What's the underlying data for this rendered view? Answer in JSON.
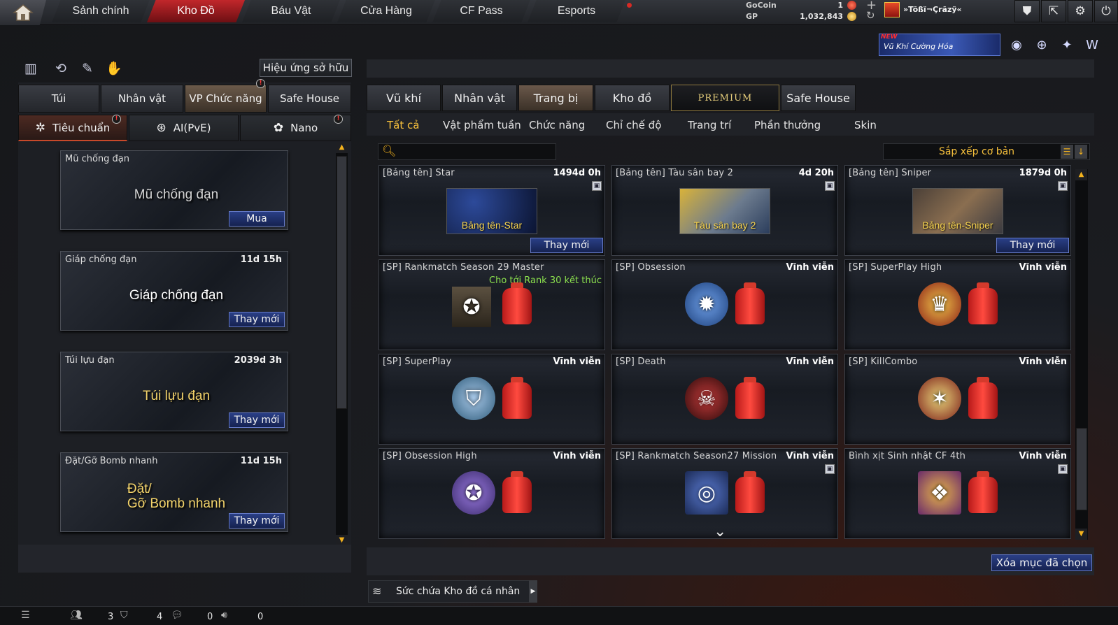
{
  "nav": {
    "tabs": [
      "Sảnh chính",
      "Kho Đồ",
      "Báu Vật",
      "Cửa Hàng",
      "CF Pass",
      "Esports"
    ],
    "active_tab": "Kho Đồ"
  },
  "currency": {
    "gocoin_label": "GoCoin",
    "gocoin_value": "1",
    "gp_label": "GP",
    "gp_value": "1,032,843"
  },
  "player": {
    "name": "»Tõßï¬Çrãzÿ«"
  },
  "event_banner": {
    "badge": "NEW",
    "text": "Vũ Khí Cường Hóa"
  },
  "left": {
    "effect_button": "Hiệu ứng sở hữu",
    "tabs": [
      "Túi",
      "Nhân vật",
      "VP Chức năng",
      "Safe House"
    ],
    "active_tab": "VP Chức năng",
    "subtabs": [
      "Tiêu chuẩn",
      "AI(PvE)",
      "Nano"
    ],
    "active_subtab": "Tiêu chuẩn",
    "items": [
      {
        "title": "Mũ chống đạn",
        "time": "",
        "art": "Mũ chống đạn",
        "button": "Mua"
      },
      {
        "title": "Giáp chống đạn",
        "time": "11d 15h",
        "art": "Giáp chống đạn",
        "button": "Thay mới"
      },
      {
        "title": "Túi lựu đạn",
        "time": "2039d 3h",
        "art": "Túi lựu đạn",
        "button": "Thay mới"
      },
      {
        "title": "Đặt/Gỡ Bomb nhanh",
        "time": "11d 15h",
        "art": "Đặt/\nGỡ Bomb nhanh",
        "button": "Thay mới"
      }
    ]
  },
  "right": {
    "tabs": [
      "Vũ khí",
      "Nhân vật",
      "Trang bị",
      "Kho đồ",
      "PREMIUM",
      "Safe House"
    ],
    "active_tab": "Trang bị",
    "subtabs": [
      "Tất cả",
      "Vật phẩm tuần",
      "Chức năng",
      "Chỉ chế độ",
      "Trang trí",
      "Phần thưởng",
      "Skin"
    ],
    "active_subtab": "Tất cả",
    "search_placeholder": "",
    "sort_label": "Sắp xếp cơ bản",
    "items": [
      {
        "title": "[Bảng tên] Star",
        "time": "1494d 0h",
        "note": "",
        "art": "Bảng tên-Star",
        "button": "Thay mới",
        "locked": true
      },
      {
        "title": "[Bảng tên] Tàu sân bay 2",
        "time": "4d 20h",
        "note": "",
        "art": "Tàu sân bay 2",
        "button": "",
        "locked": true
      },
      {
        "title": "[Bảng tên] Sniper",
        "time": "1879d 0h",
        "note": "",
        "art": "Bảng tên-Sniper",
        "button": "Thay mới",
        "locked": true
      },
      {
        "title": "[SP] Rankmatch Season 29 Master",
        "time": "",
        "note": "Cho tới Rank 30 kết thúc",
        "art": "",
        "button": "",
        "locked": false
      },
      {
        "title": "[SP] Obsession",
        "time": "Vĩnh viễn",
        "note": "",
        "art": "",
        "button": "",
        "locked": false
      },
      {
        "title": "[SP] SuperPlay High",
        "time": "Vĩnh viễn",
        "note": "",
        "art": "",
        "button": "",
        "locked": false
      },
      {
        "title": "[SP] SuperPlay",
        "time": "Vĩnh viễn",
        "note": "",
        "art": "",
        "button": "",
        "locked": false
      },
      {
        "title": "[SP] Death",
        "time": "Vĩnh viễn",
        "note": "",
        "art": "",
        "button": "",
        "locked": false
      },
      {
        "title": "[SP] KillCombo",
        "time": "Vĩnh viễn",
        "note": "",
        "art": "",
        "button": "",
        "locked": false
      },
      {
        "title": "[SP] Obsession High",
        "time": "Vĩnh viễn",
        "note": "",
        "art": "",
        "button": "",
        "locked": false
      },
      {
        "title": "[SP] Rankmatch Season27 Mission",
        "time": "Vĩnh viễn",
        "note": "",
        "art": "",
        "button": "",
        "locked": true
      },
      {
        "title": "Bình xịt Sinh nhật CF 4th",
        "time": "Vĩnh viễn",
        "note": "",
        "art": "",
        "button": "",
        "locked": true
      }
    ],
    "delete_button": "Xóa mục đã chọn",
    "capacity_label": "Sức chứa Kho đồ cá nhân"
  },
  "status": {
    "players": "3",
    "clan": "4",
    "chat": "0",
    "voice": "0"
  },
  "colors": {
    "accent_red": "#c1272b",
    "highlight_gold": "#f6c03c",
    "button_blue": "#2a3f86",
    "note_green": "#8be04e"
  }
}
